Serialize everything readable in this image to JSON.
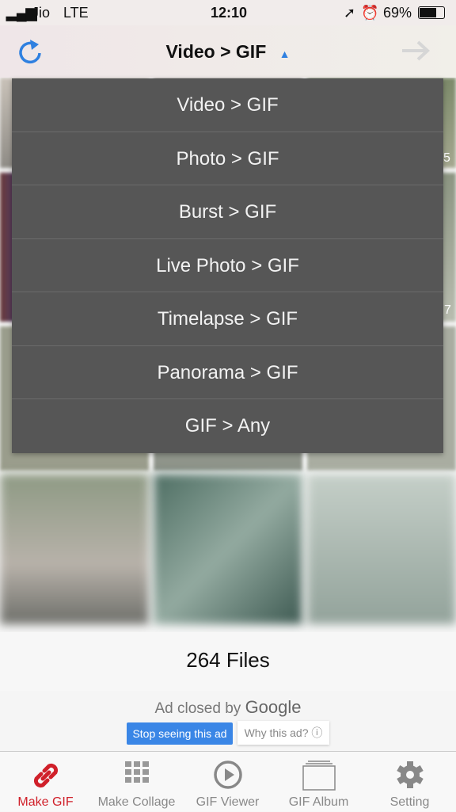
{
  "status": {
    "carrier": "Jio",
    "network": "LTE",
    "time": "12:10",
    "battery": "69%"
  },
  "nav": {
    "title": "Video > GIF",
    "left_icon": "refresh-icon",
    "right_icon": "arrow-right-icon",
    "accent": "#2f80e0"
  },
  "grid": {
    "durations": [
      "5",
      "7"
    ]
  },
  "menu": {
    "items": [
      "Video > GIF",
      "Photo > GIF",
      "Burst > GIF",
      "Live Photo > GIF",
      "Timelapse > GIF",
      "Panorama > GIF",
      "GIF > Any"
    ]
  },
  "file_count": "264 Files",
  "ad": {
    "closed_text": "Ad closed by",
    "brand": "Google",
    "stop_label": "Stop seeing this ad",
    "why_label": "Why this ad? ⓘ"
  },
  "tabs": [
    {
      "label": "Make GIF",
      "icon": "link-icon",
      "active": true
    },
    {
      "label": "Make Collage",
      "icon": "grid-icon"
    },
    {
      "label": "GIF Viewer",
      "icon": "play-icon"
    },
    {
      "label": "GIF Album",
      "icon": "album-icon"
    },
    {
      "label": "Setting",
      "icon": "gear-icon"
    }
  ],
  "colors": {
    "active_tab": "#d0202a",
    "inactive_tab": "#888888",
    "menu_bg": "#565656"
  }
}
